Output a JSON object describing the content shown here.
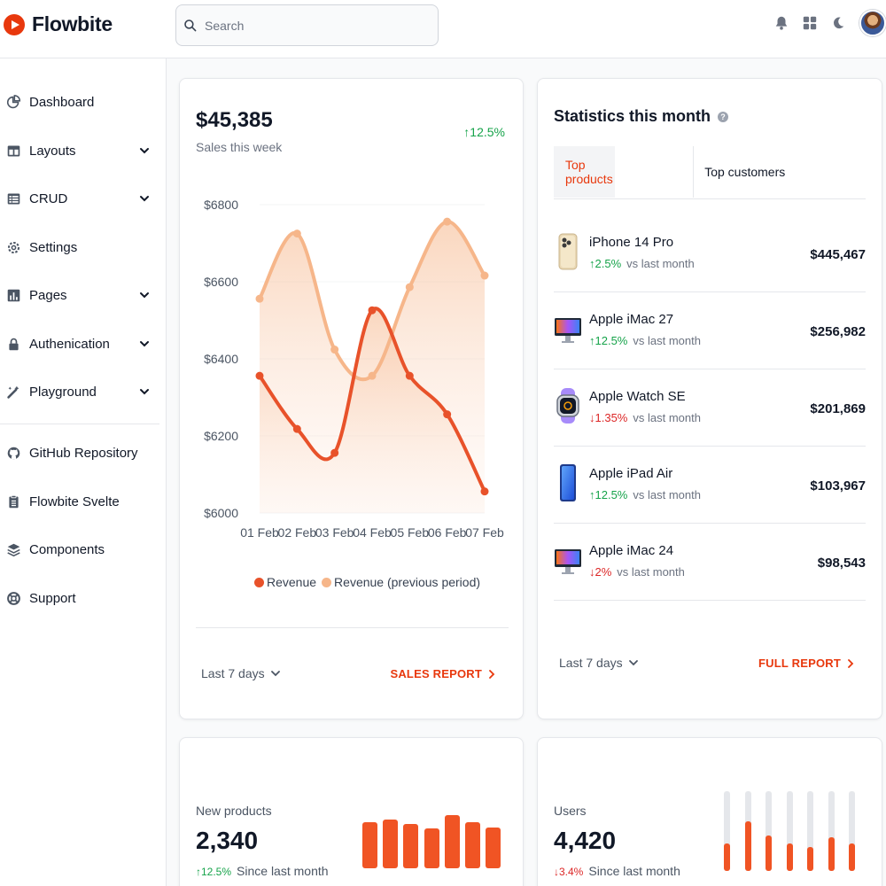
{
  "app": {
    "name": "Flowbite"
  },
  "search": {
    "placeholder": "Search"
  },
  "header": {
    "icons": [
      "bell-icon",
      "apps-grid-icon",
      "moon-icon"
    ]
  },
  "sidebar": {
    "items": [
      {
        "label": "Dashboard",
        "icon": "chart-pie-icon",
        "expandable": false
      },
      {
        "label": "Layouts",
        "icon": "layout-icon",
        "expandable": true
      },
      {
        "label": "CRUD",
        "icon": "table-icon",
        "expandable": true
      },
      {
        "label": "Settings",
        "icon": "gear-icon",
        "expandable": false
      },
      {
        "label": "Pages",
        "icon": "chart-bars-icon",
        "expandable": true
      },
      {
        "label": "Authenication",
        "icon": "lock-icon",
        "expandable": true
      },
      {
        "label": "Playground",
        "icon": "wand-icon",
        "expandable": true
      }
    ],
    "secondary": [
      {
        "label": "GitHub Repository",
        "icon": "github-icon"
      },
      {
        "label": "Flowbite Svelte",
        "icon": "clipboard-icon"
      },
      {
        "label": "Components",
        "icon": "layers-icon"
      },
      {
        "label": "Support",
        "icon": "lifebuoy-icon"
      }
    ]
  },
  "sales": {
    "value": "$45,385",
    "label": "Sales this week",
    "change": "↑12.5%",
    "legend": [
      "Revenue",
      "Revenue (previous period)"
    ],
    "range": "Last 7 days",
    "report_link": "SALES REPORT"
  },
  "chart_data": {
    "type": "area",
    "x": [
      "01 Feb",
      "02 Feb",
      "03 Feb",
      "04 Feb",
      "05 Feb",
      "06 Feb",
      "07 Feb"
    ],
    "yticks": [
      "$6800",
      "$6600",
      "$6400",
      "$6200",
      "$6000"
    ],
    "ylim": [
      6000,
      6800
    ],
    "series": [
      {
        "name": "Revenue",
        "color": "#e8522a",
        "values": [
          6356,
          6218,
          6156,
          6526,
          6356,
          6256,
          6056
        ]
      },
      {
        "name": "Revenue (previous period)",
        "color": "#f6b68a",
        "values": [
          6556,
          6725,
          6424,
          6356,
          6586,
          6756,
          6616
        ]
      }
    ],
    "legend_position": "bottom"
  },
  "stats": {
    "title": "Statistics this month",
    "tabs": [
      "Top products",
      "Top customers"
    ],
    "products": [
      {
        "name": "iPhone 14 Pro",
        "change": "↑2.5%",
        "direction": "up",
        "note": "vs last month",
        "price": "$445,467",
        "icon": "iphone-icon"
      },
      {
        "name": "Apple iMac 27",
        "change": "↑12.5%",
        "direction": "up",
        "note": "vs last month",
        "price": "$256,982",
        "icon": "imac-icon"
      },
      {
        "name": "Apple Watch SE",
        "change": "↓1.35%",
        "direction": "down",
        "note": "vs last month",
        "price": "$201,869",
        "icon": "watch-icon"
      },
      {
        "name": "Apple iPad Air",
        "change": "↑12.5%",
        "direction": "up",
        "note": "vs last month",
        "price": "$103,967",
        "icon": "ipad-icon"
      },
      {
        "name": "Apple iMac 24",
        "change": "↓2%",
        "direction": "down",
        "note": "vs last month",
        "price": "$98,543",
        "icon": "imac-icon"
      }
    ],
    "range": "Last 7 days",
    "report_link": "FULL REPORT"
  },
  "new_products": {
    "label": "New products",
    "value": "2,340",
    "change": "↑12.5%",
    "note": "Since last month",
    "bars": [
      0.74,
      0.78,
      0.72,
      0.64,
      0.86,
      0.74,
      0.66
    ]
  },
  "users": {
    "label": "Users",
    "value": "4,420",
    "change": "↓3.4%",
    "note": "Since last month",
    "bars": [
      0.34,
      0.62,
      0.44,
      0.34,
      0.3,
      0.42,
      0.34
    ]
  },
  "colors": {
    "accent": "#e8380d",
    "up": "#16a34a",
    "down": "#dc2626"
  }
}
